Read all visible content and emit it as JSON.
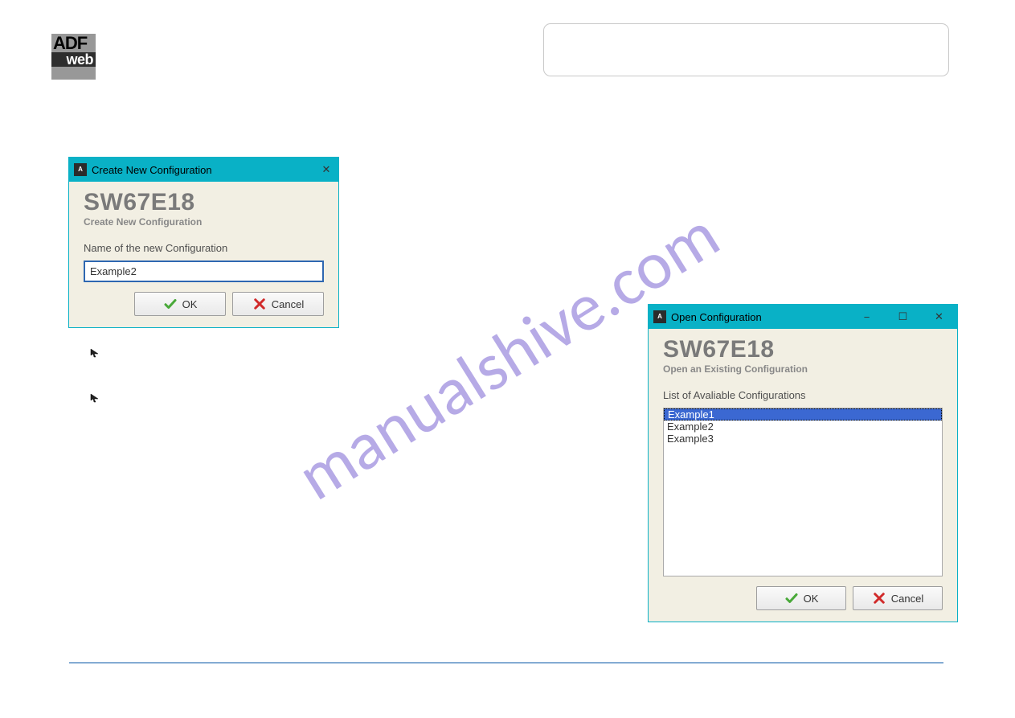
{
  "logo": {
    "top": "ADF",
    "bottom": "web"
  },
  "watermark": "manualshive.com",
  "dialog_create": {
    "title": "Create New Configuration",
    "heading": "SW67E18",
    "subheading": "Create New Configuration",
    "field_label": "Name of the new Configuration",
    "field_value": "Example2",
    "ok_label": "OK",
    "cancel_label": "Cancel"
  },
  "dialog_open": {
    "title": "Open Configuration",
    "heading": "SW67E18",
    "subheading": "Open an Existing Configuration",
    "list_label": "List of Avaliable Configurations",
    "items": [
      "Example1",
      "Example2",
      "Example3"
    ],
    "ok_label": "OK",
    "cancel_label": "Cancel",
    "minimize": "−",
    "maximize": "☐",
    "close": "✕"
  }
}
